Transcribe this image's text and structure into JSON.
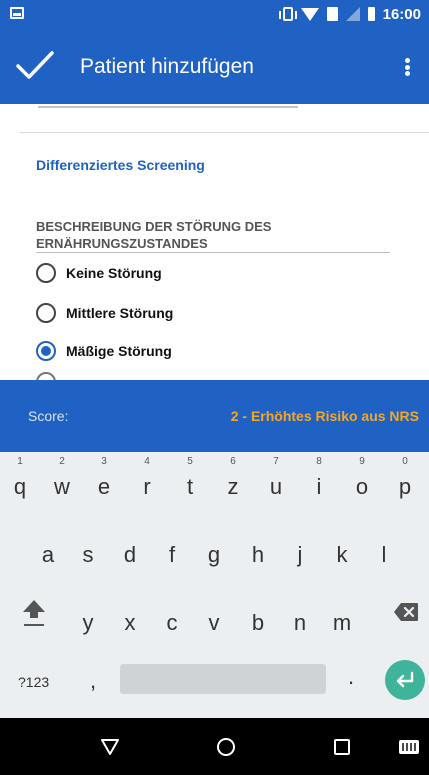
{
  "status_bar": {
    "time": "16:00",
    "icons": [
      "screenshot-icon",
      "vibrate-icon",
      "wifi-icon",
      "sim-data-icon",
      "signal-icon",
      "battery-icon"
    ]
  },
  "app_bar": {
    "title": "Patient hinzufügen",
    "confirm_icon": "check-icon",
    "menu_icon": "overflow-menu-icon"
  },
  "form": {
    "section_title": "Differenziertes Screening",
    "question": "BESCHREIBUNG DER STÖRUNG DES ERNÄHRUNGSZUSTANDES",
    "options": [
      {
        "label": "Keine Störung",
        "checked": false
      },
      {
        "label": "Mittlere Störung",
        "checked": false
      },
      {
        "label": "Mäßige Störung",
        "checked": true
      }
    ]
  },
  "score": {
    "label": "Score:",
    "value": "2 - Erhöhtes Risiko aus NRS"
  },
  "keyboard": {
    "row1": [
      {
        "key": "q",
        "hint": "1"
      },
      {
        "key": "w",
        "hint": "2"
      },
      {
        "key": "e",
        "hint": "3"
      },
      {
        "key": "r",
        "hint": "4"
      },
      {
        "key": "t",
        "hint": "5"
      },
      {
        "key": "z",
        "hint": "6"
      },
      {
        "key": "u",
        "hint": "7"
      },
      {
        "key": "i",
        "hint": "8"
      },
      {
        "key": "o",
        "hint": "9"
      },
      {
        "key": "p",
        "hint": "0"
      }
    ],
    "row2": [
      "a",
      "s",
      "d",
      "f",
      "g",
      "h",
      "j",
      "k",
      "l"
    ],
    "row3": [
      "y",
      "x",
      "c",
      "v",
      "b",
      "n",
      "m"
    ],
    "symbols_label": "?123",
    "comma": ",",
    "period": ".",
    "accent_color": "#3fb49a"
  },
  "colors": {
    "primary": "#1f62c4",
    "score_value": "#f5a623"
  }
}
